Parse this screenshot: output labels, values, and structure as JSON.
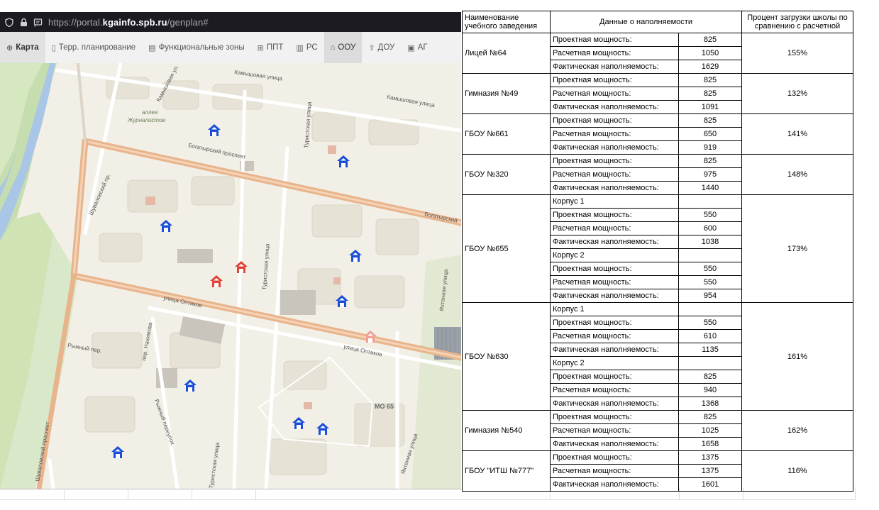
{
  "browser": {
    "url_prefix": "https://portal.",
    "url_host": "kgainfo.spb.ru",
    "url_path": "/genplan#"
  },
  "nav": {
    "tabs": [
      {
        "icon": "globe-icon",
        "label": "Карта"
      },
      {
        "icon": "document-icon",
        "label": "Терр. планирование"
      },
      {
        "icon": "grid-icon",
        "label": "Функциональные зоны"
      },
      {
        "icon": "table-icon",
        "label": "ППТ"
      },
      {
        "icon": "building-icon",
        "label": "РС"
      },
      {
        "icon": "school-icon",
        "label": "ООУ"
      },
      {
        "icon": "kindergarten-icon",
        "label": "ДОУ"
      },
      {
        "icon": "map-frame-icon",
        "label": "АГ"
      }
    ]
  },
  "map": {
    "labels": {
      "kamyshovaya1": "Камышовая улица",
      "kamyshovaya2": "Камышовая улица",
      "kamyshovaya_ul": "Камышовая ул.",
      "alleya": "аллея",
      "zhurnalistov": "Журналистов",
      "bogatyrsky": "Богатырский проспект",
      "bogatyrsk2": "Богатырский",
      "turistskaya1": "Туристская улица",
      "turistskaya2": "Туристская улица",
      "turistskaya3": "Туристская улица",
      "shuvalovsky": "Шуваловский пр.",
      "optikov1": "улица Оптиков",
      "optikov2": "улица Оптиков",
      "yakhtennaya1": "Яхтенная улица",
      "yakhtennaya2": "Яхтенная улица",
      "nakhimova": "пер. Нахимова",
      "ryzhiy": "Рыжный пер.",
      "ryzhiy2": "Рыжный переулок",
      "mo": "МО 65",
      "shuvalovsky2": "Шуваловский проспект"
    },
    "colors": {
      "school_blue": "#1a4fd6",
      "school_red": "#e0453a",
      "school_faded": "#f0a093",
      "road": "#e8b48c",
      "park": "#cfe3b4",
      "water": "#a9c6e6"
    }
  },
  "table": {
    "headers": {
      "name": "Наименование учебного заведения",
      "data": "Данные о наполняемости",
      "percent": "Процент загрузки школы по сравнению с расчетной"
    },
    "schools": [
      {
        "name": "Лицей №64",
        "percent": "155%",
        "rows": [
          {
            "label": "Проектная мощность:",
            "value": "825"
          },
          {
            "label": "Расчетная мощность:",
            "value": "1050"
          },
          {
            "label": "Фактическая наполняемость:",
            "value": "1629"
          }
        ]
      },
      {
        "name": "Гимназия №49",
        "percent": "132%",
        "rows": [
          {
            "label": "Проектная мощность:",
            "value": "825"
          },
          {
            "label": "Расчетная мощность:",
            "value": "825"
          },
          {
            "label": "Фактическая наполняемость:",
            "value": "1091"
          }
        ]
      },
      {
        "name": "ГБОУ №661",
        "percent": "141%",
        "rows": [
          {
            "label": "Проектная мощность:",
            "value": "825"
          },
          {
            "label": "Расчетная мощность:",
            "value": "650"
          },
          {
            "label": "Фактическая наполняемость:",
            "value": "919"
          }
        ]
      },
      {
        "name": "ГБОУ №320",
        "percent": "148%",
        "rows": [
          {
            "label": "Проектная мощность:",
            "value": "825"
          },
          {
            "label": "Расчетная мощность:",
            "value": "975"
          },
          {
            "label": "Фактическая наполняемость:",
            "value": "1440"
          }
        ]
      },
      {
        "name": "ГБОУ №655",
        "percent": "173%",
        "rows": [
          {
            "label": "Корпус 1",
            "value": ""
          },
          {
            "label": "Проектная мощность:",
            "value": "550"
          },
          {
            "label": "Расчетная мощность:",
            "value": "600"
          },
          {
            "label": "Фактическая наполняемость:",
            "value": "1038"
          },
          {
            "label": "Корпус 2",
            "value": ""
          },
          {
            "label": "Проектная мощность:",
            "value": "550"
          },
          {
            "label": "Расчетная мощность:",
            "value": "550"
          },
          {
            "label": "Фактическая наполняемость:",
            "value": "954"
          }
        ]
      },
      {
        "name": "ГБОУ №630",
        "percent": "161%",
        "rows": [
          {
            "label": "Корпус 1",
            "value": ""
          },
          {
            "label": "Проектная мощность:",
            "value": "550"
          },
          {
            "label": "Расчетная мощность:",
            "value": "610"
          },
          {
            "label": "Фактическая наполняемость:",
            "value": "1135"
          },
          {
            "label": "Корпус 2",
            "value": ""
          },
          {
            "label": "Проектная мощность:",
            "value": "825"
          },
          {
            "label": "Расчетная мощность:",
            "value": "940"
          },
          {
            "label": "Фактическая наполняемость:",
            "value": "1368"
          }
        ]
      },
      {
        "name": "Гимназия №540",
        "percent": "162%",
        "rows": [
          {
            "label": "Проектная мощность:",
            "value": "825"
          },
          {
            "label": "Расчетная мощность:",
            "value": "1025"
          },
          {
            "label": "Фактическая наполняемость:",
            "value": "1658"
          }
        ]
      },
      {
        "name": "ГБОУ \"ИТШ №777\"",
        "percent": "116%",
        "rows": [
          {
            "label": "Проектная мощность:",
            "value": "1375"
          },
          {
            "label": "Расчетная мощность:",
            "value": "1375"
          },
          {
            "label": "Фактическая наполняемость:",
            "value": "1601"
          }
        ]
      }
    ]
  }
}
